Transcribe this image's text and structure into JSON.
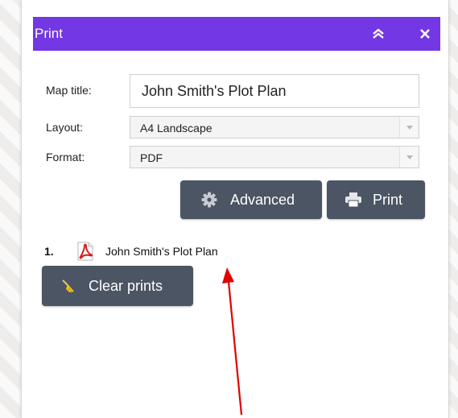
{
  "window": {
    "title": "Print"
  },
  "form": {
    "map_title_label": "Map title:",
    "map_title_value": "John Smith's Plot Plan",
    "layout_label": "Layout:",
    "layout_value": "A4 Landscape",
    "format_label": "Format:",
    "format_value": "PDF"
  },
  "buttons": {
    "advanced_label": "Advanced",
    "print_label": "Print",
    "clear_label": "Clear prints"
  },
  "results": [
    {
      "index": "1.",
      "name": "John Smith's Plot Plan",
      "icon": "pdf-file-icon"
    }
  ],
  "colors": {
    "title_bar": "#7337e3",
    "button": "#4b5563",
    "annotation_arrow": "#e00000"
  }
}
